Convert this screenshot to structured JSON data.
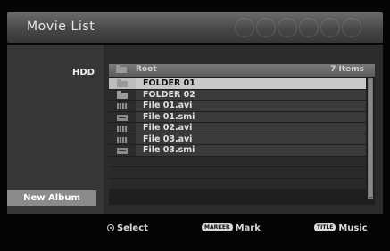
{
  "header": {
    "title": "Movie List"
  },
  "sidebar": {
    "device": "HDD",
    "new_album": "New Album"
  },
  "list": {
    "root": "Root",
    "count": "7 Items",
    "items": [
      {
        "name": "FOLDER 01",
        "icon": "folder-icon",
        "selected": true
      },
      {
        "name": "FOLDER 02",
        "icon": "folder-icon"
      },
      {
        "name": "File 01.avi",
        "icon": "video-file-icon"
      },
      {
        "name": "File 01.smi",
        "icon": "subtitle-file-icon"
      },
      {
        "name": "File 02.avi",
        "icon": "video-file-icon"
      },
      {
        "name": "File 03.avi",
        "icon": "video-file-icon"
      },
      {
        "name": "File 03.smi",
        "icon": "subtitle-file-icon"
      }
    ]
  },
  "footer": {
    "select": "Select",
    "marker_key": "MARKER",
    "mark": "Mark",
    "title_key": "TITLE",
    "music": "Music"
  },
  "colors": {
    "selected_row": "#c9c9c9",
    "background": "#050505",
    "button": "#8b8b8b"
  }
}
